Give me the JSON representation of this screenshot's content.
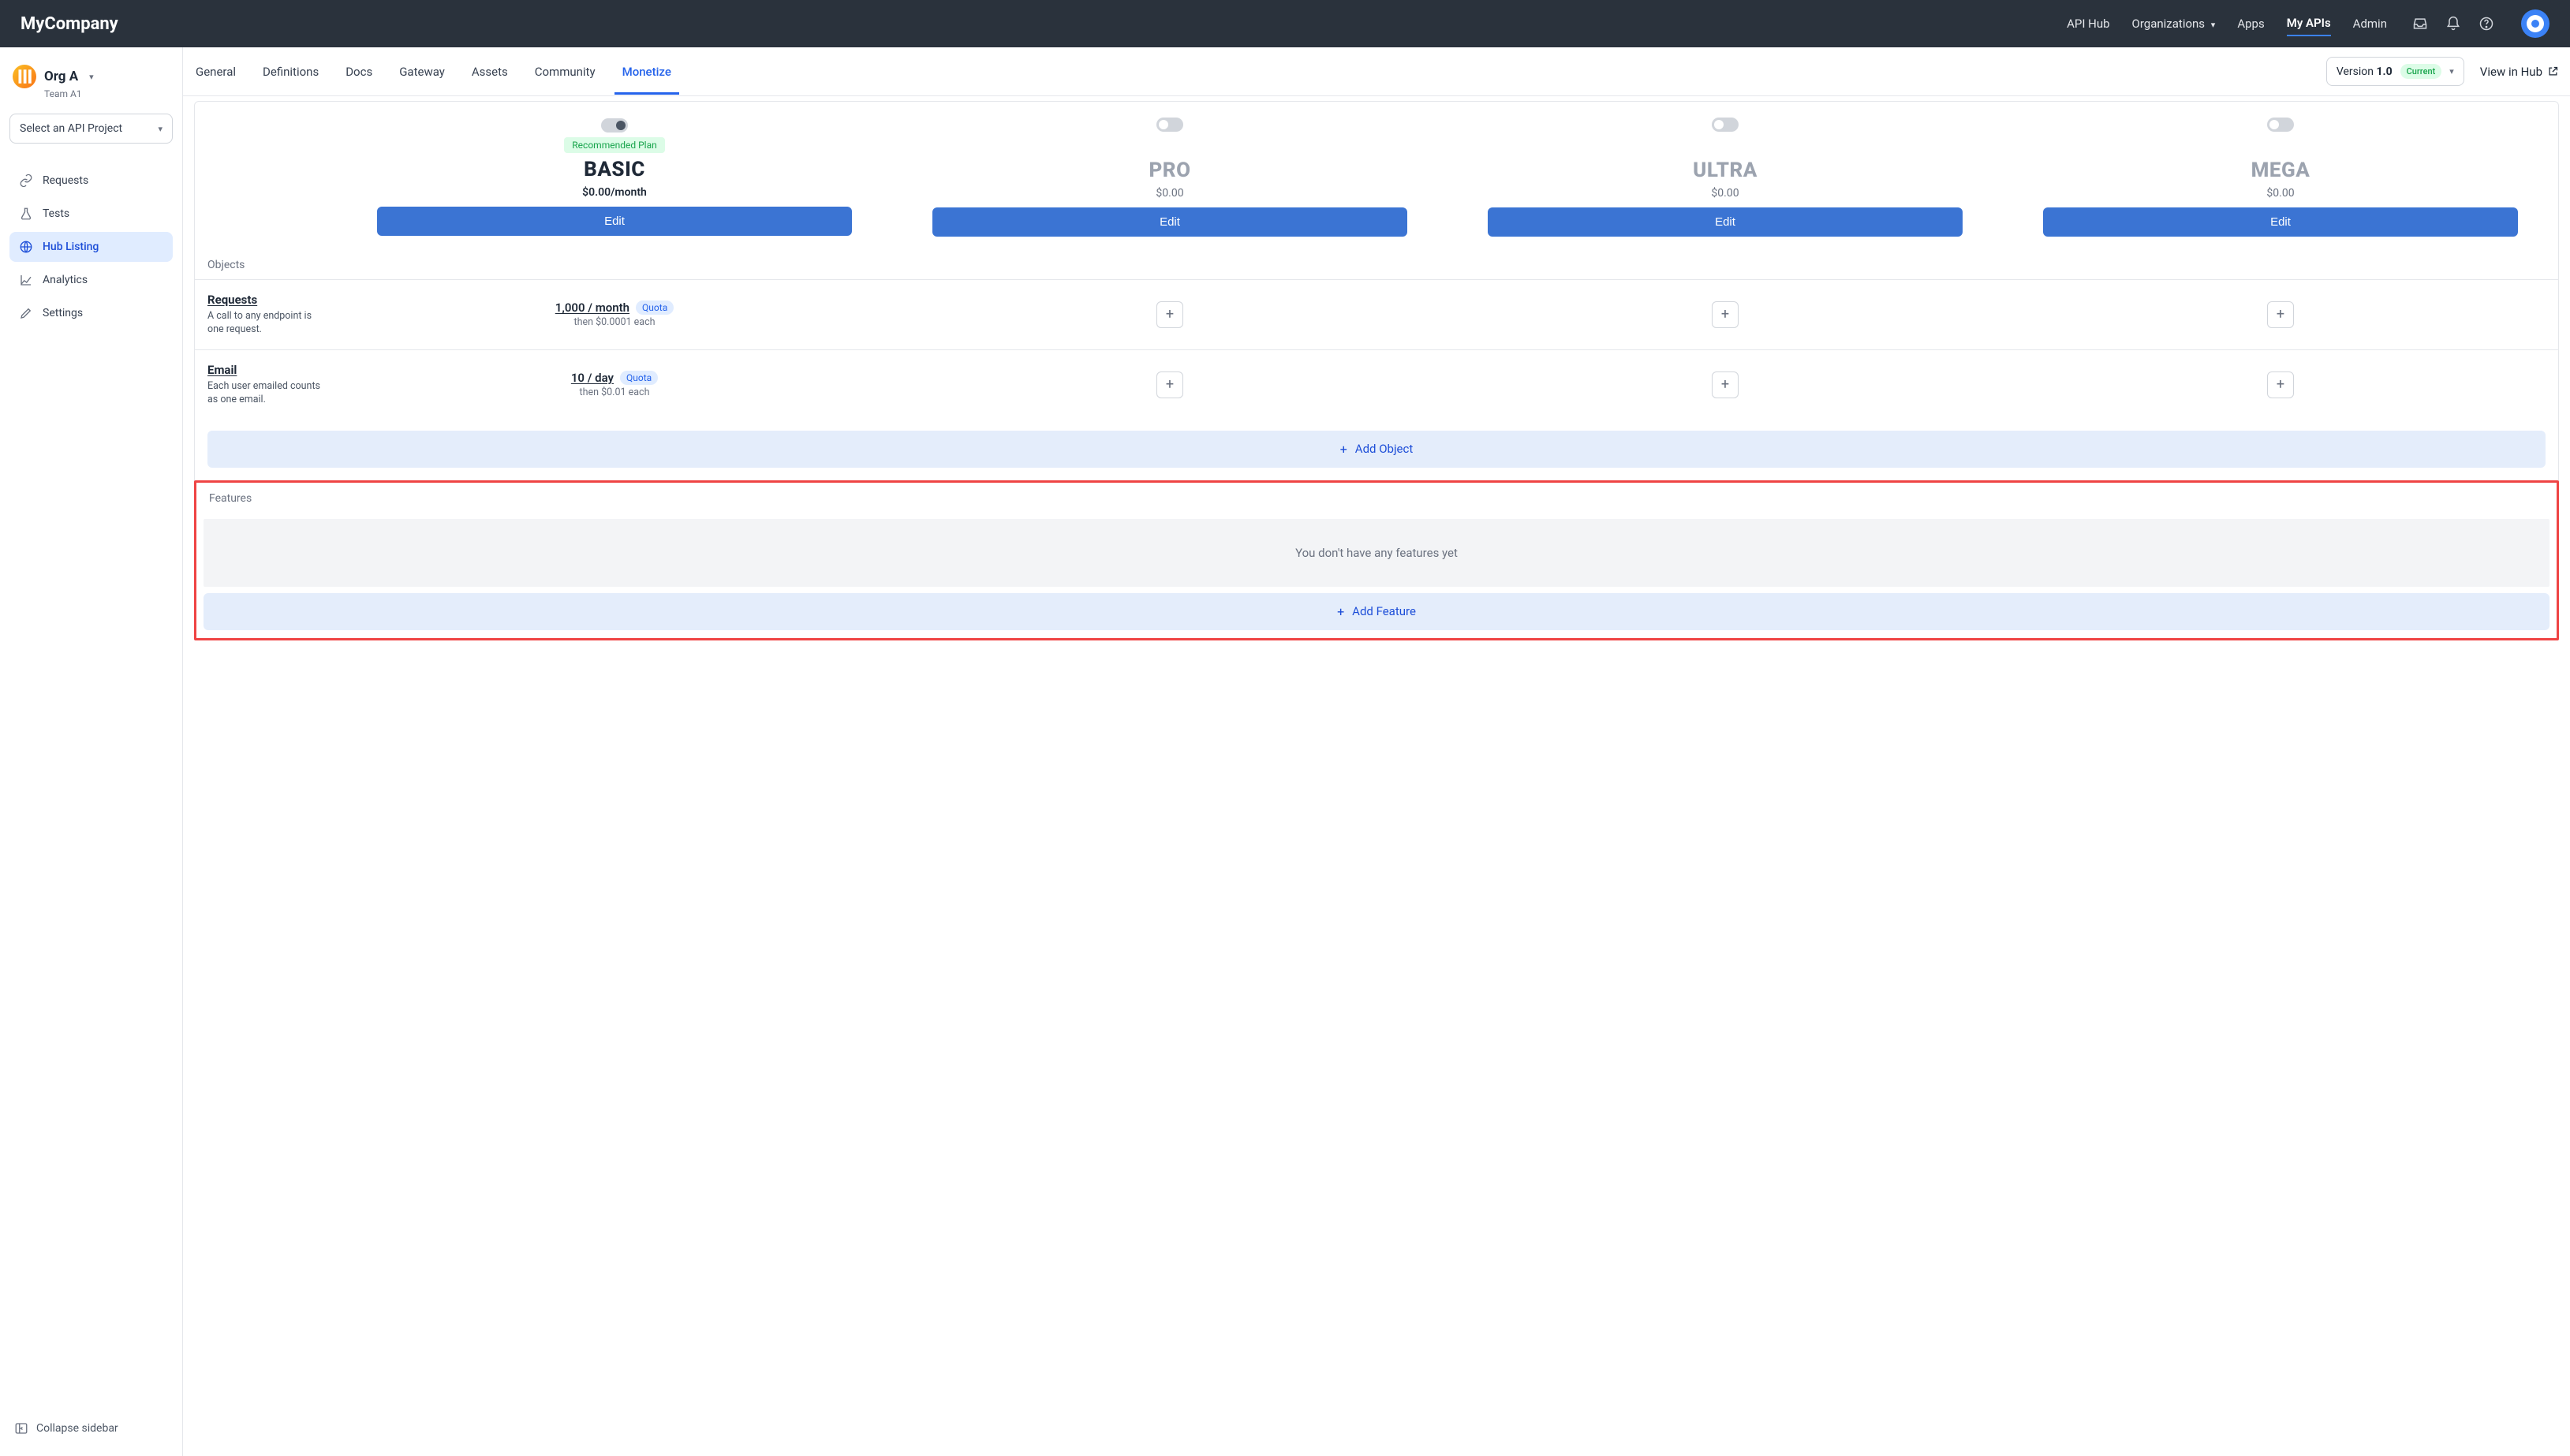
{
  "brand": "MyCompany",
  "topnav": {
    "api_hub": "API Hub",
    "organizations": "Organizations",
    "apps": "Apps",
    "my_apis": "My APIs",
    "admin": "Admin"
  },
  "sidebar": {
    "org_name": "Org A",
    "team_name": "Team A1",
    "project_select": "Select an API Project",
    "items": [
      {
        "label": "Requests"
      },
      {
        "label": "Tests"
      },
      {
        "label": "Hub Listing"
      },
      {
        "label": "Analytics"
      },
      {
        "label": "Settings"
      }
    ],
    "collapse": "Collapse sidebar"
  },
  "tabs": {
    "general": "General",
    "definitions": "Definitions",
    "docs": "Docs",
    "gateway": "Gateway",
    "assets": "Assets",
    "community": "Community",
    "monetize": "Monetize"
  },
  "toolbar": {
    "version_prefix": "Version ",
    "version_value": "1.0",
    "current_badge": "Current",
    "view_in_hub": "View in Hub"
  },
  "plans": {
    "recommended_badge": "Recommended Plan",
    "edit_label": "Edit",
    "basic": {
      "name": "BASIC",
      "price": "$0.00/month"
    },
    "pro": {
      "name": "PRO",
      "price": "$0.00"
    },
    "ultra": {
      "name": "ULTRA",
      "price": "$0.00"
    },
    "mega": {
      "name": "MEGA",
      "price": "$0.00"
    }
  },
  "objects": {
    "label": "Objects",
    "quota_badge": "Quota",
    "add_label": "Add Object",
    "rows": [
      {
        "title": "Requests",
        "sub": "A call to any endpoint is one request.",
        "main": "1,000 / month",
        "sub2": "then $0.0001 each"
      },
      {
        "title": "Email",
        "sub": "Each user emailed counts as one email.",
        "main": "10 / day",
        "sub2": "then $0.01 each"
      }
    ]
  },
  "features": {
    "label": "Features",
    "empty": "You don't have any features yet",
    "add_label": "Add Feature"
  }
}
